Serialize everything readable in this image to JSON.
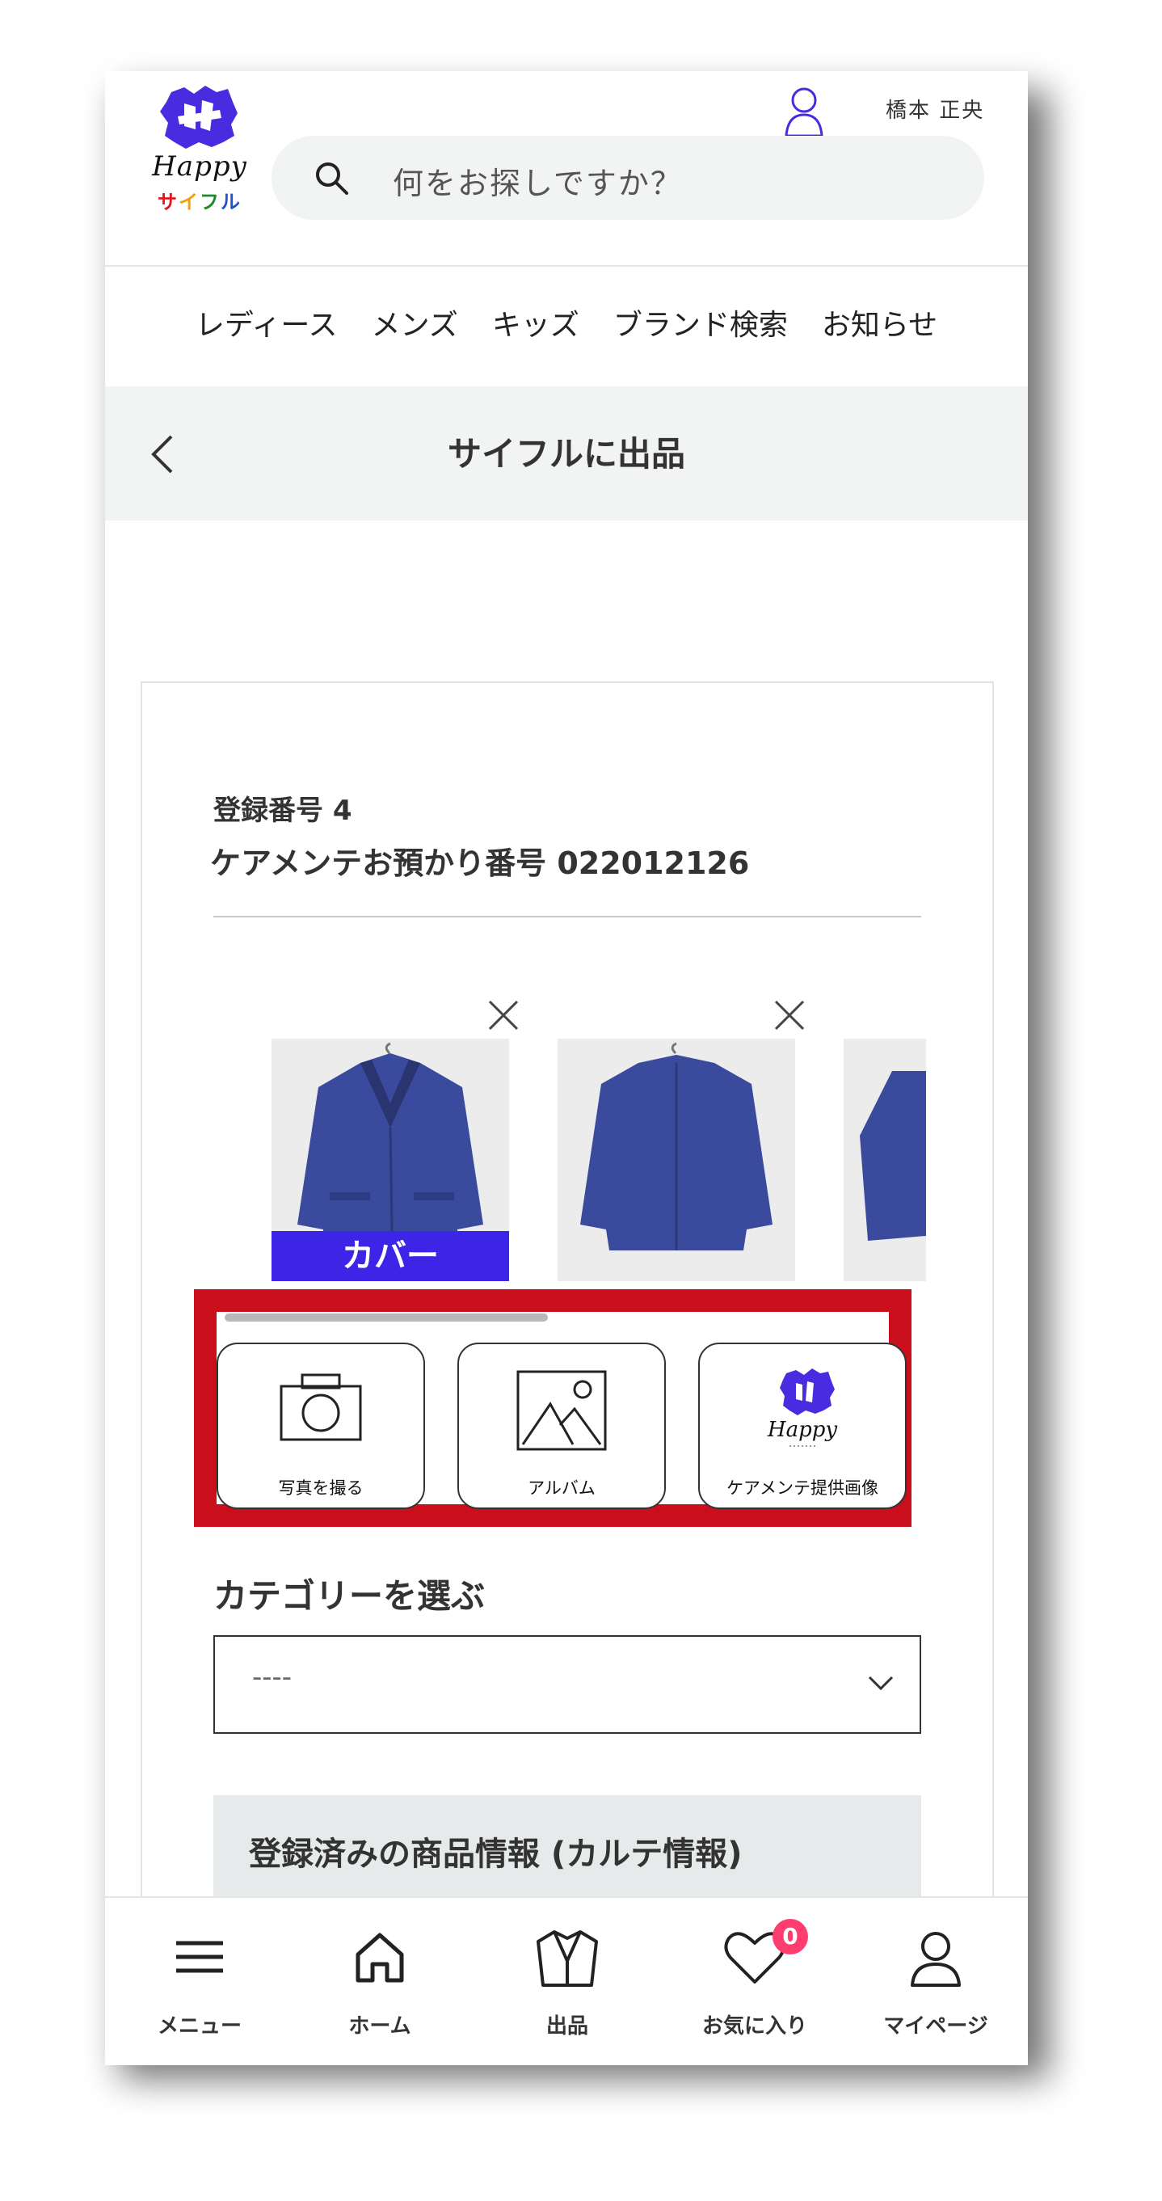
{
  "header": {
    "logo_word": "Happy",
    "logo_sub": [
      "サ",
      "イ",
      "フ",
      "ル"
    ],
    "user_name": "橋本 正央",
    "search_placeholder": "何をお探しですか？"
  },
  "nav": [
    "レディース",
    "メンズ",
    "キッズ",
    "ブランド検索",
    "お知らせ"
  ],
  "page": {
    "title": "サイフルに出品"
  },
  "listing": {
    "registration": "登録番号 4",
    "care_number": "ケアメンテお預かり番号 022012126",
    "cover_label": "カバー",
    "photo_sources": [
      {
        "label": "写真を撮る",
        "icon": "camera-icon"
      },
      {
        "label": "アルバム",
        "icon": "album-icon"
      },
      {
        "label": "ケアメンテ提供画像",
        "icon": "happy-logo-icon"
      }
    ],
    "category_title": "カテゴリーを選ぶ",
    "category_value": "----",
    "karte_title": "登録済みの商品情報 (カルテ情報)"
  },
  "colors": {
    "accent": "#3d25e7",
    "highlight": "#c90f1b",
    "badge": "#ff3d6e"
  },
  "bottom_nav": [
    {
      "label": "メニュー",
      "icon": "menu-icon"
    },
    {
      "label": "ホーム",
      "icon": "home-icon"
    },
    {
      "label": "出品",
      "icon": "sell-icon"
    },
    {
      "label": "お気に入り",
      "icon": "heart-icon",
      "badge": "0"
    },
    {
      "label": "マイページ",
      "icon": "user-icon"
    }
  ]
}
